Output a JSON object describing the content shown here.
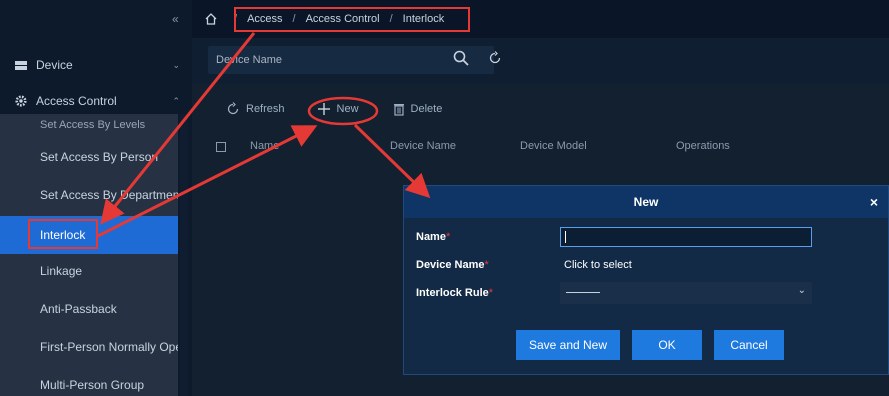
{
  "sidebar": {
    "collapse_icon": "double-chevron-left",
    "device": {
      "label": "Device",
      "icon": "device-icon"
    },
    "access_control": {
      "label": "Access Control",
      "icon": "gear-icon"
    },
    "partial_item": "Set Access By Levels",
    "items": [
      {
        "label": "Set Access By Person"
      },
      {
        "label": "Set Access By Department"
      },
      {
        "label": "Interlock"
      },
      {
        "label": "Linkage"
      },
      {
        "label": "Anti-Passback"
      },
      {
        "label": "First-Person Normally Open"
      },
      {
        "label": "Multi-Person Group"
      }
    ]
  },
  "breadcrumb": {
    "items": [
      "Access",
      "Access Control",
      "Interlock"
    ],
    "separator": "/"
  },
  "search": {
    "placeholder": "Device Name"
  },
  "toolbar": {
    "refresh": "Refresh",
    "new": "New",
    "delete": "Delete"
  },
  "table": {
    "columns": [
      "Name",
      "Device Name",
      "Device Model",
      "Operations"
    ]
  },
  "dialog": {
    "title": "New",
    "close": "×",
    "fields": {
      "name_label": "Name",
      "device_label": "Device Name",
      "device_value": "Click to select",
      "rule_label": "Interlock Rule",
      "rule_value": "———"
    },
    "required_mark": "*",
    "buttons": {
      "save_new": "Save and New",
      "ok": "OK",
      "cancel": "Cancel"
    }
  },
  "colors": {
    "accent": "#1f7ae0",
    "annotation": "#e53935",
    "active_item": "#1e6bd6"
  }
}
